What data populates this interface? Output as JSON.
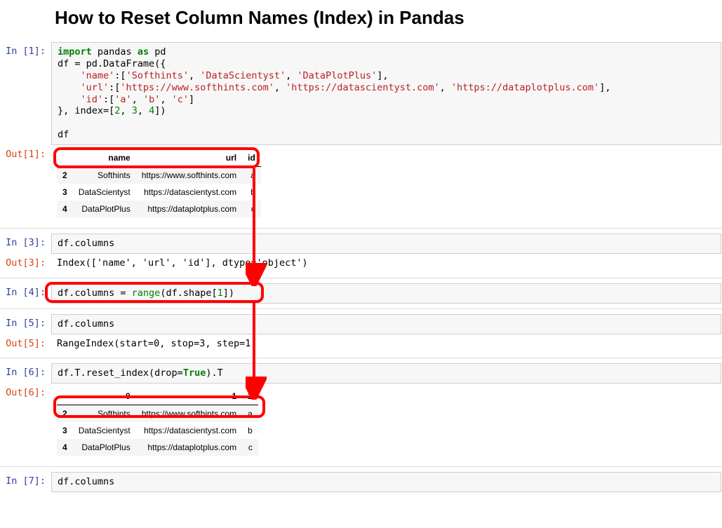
{
  "title": "How to Reset Column Names (Index) in Pandas",
  "cells": {
    "c1": {
      "in_prompt": "In [1]:",
      "out_prompt": "Out[1]:",
      "code": {
        "import": "import",
        "pandas": " pandas ",
        "as": "as",
        "pd": " pd",
        "l2a": "df = pd.DataFrame({",
        "l3a": "    ",
        "l3k": "'name'",
        "l3b": ":[",
        "l3v1": "'Softhints'",
        "l3c1": ", ",
        "l3v2": "'DataScientyst'",
        "l3c2": ", ",
        "l3v3": "'DataPlotPlus'",
        "l3e": "],",
        "l4a": "    ",
        "l4k": "'url'",
        "l4b": ":[",
        "l4v1": "'https://www.softhints.com'",
        "l4c1": ", ",
        "l4v2": "'https://datascientyst.com'",
        "l4c2": ", ",
        "l4v3": "'https://dataplotplus.com'",
        "l4e": "],",
        "l5a": "    ",
        "l5k": "'id'",
        "l5b": ":[",
        "l5v1": "'a'",
        "l5c1": ", ",
        "l5v2": "'b'",
        "l5c2": ", ",
        "l5v3": "'c'",
        "l5e": "]",
        "l6a": "}, index=[",
        "l6n1": "2",
        "l6c1": ", ",
        "l6n2": "3",
        "l6c2": ", ",
        "l6n3": "4",
        "l6e": "])",
        "l8": "df"
      },
      "table": {
        "headers": {
          "h1": "name",
          "h2": "url",
          "h3": "id"
        },
        "rows": [
          {
            "idx": "2",
            "c1": "Softhints",
            "c2": "https://www.softhints.com",
            "c3": "a"
          },
          {
            "idx": "3",
            "c1": "DataScientyst",
            "c2": "https://datascientyst.com",
            "c3": "b"
          },
          {
            "idx": "4",
            "c1": "DataPlotPlus",
            "c2": "https://dataplotplus.com",
            "c3": "c"
          }
        ]
      }
    },
    "c3": {
      "in_prompt": "In [3]:",
      "out_prompt": "Out[3]:",
      "code": "df.columns",
      "output": "Index(['name', 'url', 'id'], dtype='object')"
    },
    "c4": {
      "in_prompt": "In [4]:",
      "code_a": "df.columns = ",
      "code_range": "range",
      "code_b": "(df.shape[",
      "code_n": "1",
      "code_c": "])"
    },
    "c5": {
      "in_prompt": "In [5]:",
      "out_prompt": "Out[5]:",
      "code": "df.columns",
      "output": "RangeIndex(start=0, stop=3, step=1)"
    },
    "c6": {
      "in_prompt": "In [6]:",
      "out_prompt": "Out[6]:",
      "code_a": "df.T.reset_index(drop=",
      "code_true": "True",
      "code_b": ").T",
      "table": {
        "headers": {
          "h1": "0",
          "h2": "1",
          "h3": "2"
        },
        "rows": [
          {
            "idx": "2",
            "c1": "Softhints",
            "c2": "https://www.softhints.com",
            "c3": "a"
          },
          {
            "idx": "3",
            "c1": "DataScientyst",
            "c2": "https://datascientyst.com",
            "c3": "b"
          },
          {
            "idx": "4",
            "c1": "DataPlotPlus",
            "c2": "https://dataplotplus.com",
            "c3": "c"
          }
        ]
      }
    },
    "c7": {
      "in_prompt": "In [7]:",
      "code": "df.columns"
    }
  }
}
